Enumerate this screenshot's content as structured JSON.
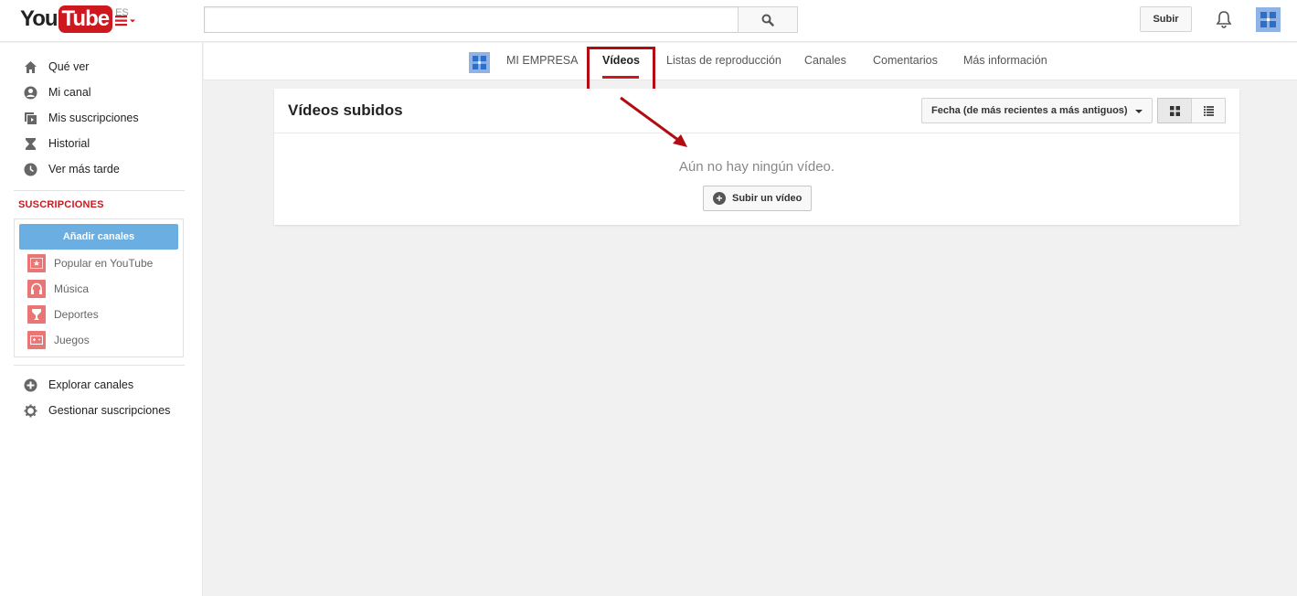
{
  "header": {
    "logo_you": "You",
    "logo_tube": "Tube",
    "region": "ES",
    "search_value": "",
    "upload_label": "Subir"
  },
  "sidebar": {
    "nav": [
      {
        "label": "Qué ver",
        "icon": "home-icon"
      },
      {
        "label": "Mi canal",
        "icon": "user-icon"
      },
      {
        "label": "Mis suscripciones",
        "icon": "subscriptions-icon"
      },
      {
        "label": "Historial",
        "icon": "hourglass-icon"
      },
      {
        "label": "Ver más tarde",
        "icon": "clock-icon"
      }
    ],
    "subscriptions_title": "SUSCRIPCIONES",
    "add_channels_label": "Añadir canales",
    "subscriptions": [
      {
        "label": "Popular en YouTube",
        "icon": "star-icon"
      },
      {
        "label": "Música",
        "icon": "headphones-icon"
      },
      {
        "label": "Deportes",
        "icon": "trophy-icon"
      },
      {
        "label": "Juegos",
        "icon": "gamepad-icon"
      }
    ],
    "bottom": [
      {
        "label": "Explorar canales",
        "icon": "plus-circle-icon"
      },
      {
        "label": "Gestionar suscripciones",
        "icon": "gear-icon"
      }
    ]
  },
  "channel_nav": {
    "tabs": [
      {
        "label": "MI EMPRESA",
        "active": false
      },
      {
        "label": "Vídeos",
        "active": true
      },
      {
        "label": "Listas de reproducción",
        "active": false
      },
      {
        "label": "Canales",
        "active": false
      },
      {
        "label": "Comentarios",
        "active": false
      },
      {
        "label": "Más información",
        "active": false
      }
    ]
  },
  "content": {
    "title": "Vídeos subidos",
    "sort_label": "Fecha (de más recientes a más antiguos)",
    "empty_message": "Aún no hay ningún vídeo.",
    "upload_video_label": "Subir un vídeo"
  },
  "colors": {
    "brand_red": "#cc181e",
    "accent_blue": "#6aaee2",
    "annotation_red": "#b20c12"
  }
}
